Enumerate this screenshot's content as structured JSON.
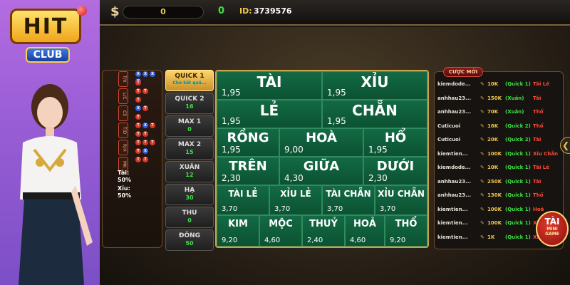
{
  "brand": {
    "logo_main": "HIT",
    "logo_sub": "CLUB"
  },
  "topbar": {
    "currency_symbol": "$",
    "balance": "0",
    "bonus": "0",
    "id_label": "ID:",
    "id_value": "3739576"
  },
  "stats": {
    "tags": [
      "T/X",
      "L/C",
      "CS",
      "T/D",
      "R/H",
      "MK"
    ],
    "rows": [
      [
        "X",
        "X",
        "X",
        "X"
      ],
      [
        "T"
      ],
      [
        "T",
        "T"
      ],
      [
        "T"
      ],
      [
        "X",
        "T"
      ],
      [
        "T"
      ],
      [
        "T",
        "X",
        "T"
      ],
      [
        "T",
        "T"
      ],
      [
        "T",
        "T",
        "T"
      ],
      [
        "T",
        "X"
      ],
      [
        "T",
        "T"
      ]
    ],
    "tai_label": "Tài:",
    "tai_pct": "50%",
    "xiu_label": "Xỉu:",
    "xiu_pct": "50%"
  },
  "tabs": [
    {
      "label": "QUICK 1",
      "count": "Chờ kết quả...",
      "active": true
    },
    {
      "label": "QUICK 2",
      "count": "16"
    },
    {
      "label": "MAX 1",
      "count": "0"
    },
    {
      "label": "MAX 2",
      "count": "15"
    },
    {
      "label": "XUÂN",
      "count": "12"
    },
    {
      "label": "HẠ",
      "count": "30"
    },
    {
      "label": "THU",
      "count": "0"
    },
    {
      "label": "ĐÔNG",
      "count": "50"
    }
  ],
  "board": {
    "row1": [
      {
        "name": "TÀI",
        "odd": "1,95"
      },
      {
        "name": "XỈU",
        "odd": "1,95"
      }
    ],
    "row2": [
      {
        "name": "LẺ",
        "odd": "1,95"
      },
      {
        "name": "CHẴN",
        "odd": "1,95"
      }
    ],
    "row3": [
      {
        "name": "RỒNG",
        "odd": "1,95"
      },
      {
        "name": "HOÀ",
        "odd": "9,00"
      },
      {
        "name": "HỔ",
        "odd": "1,95"
      }
    ],
    "row4": [
      {
        "name": "TRÊN",
        "odd": "2,30"
      },
      {
        "name": "GIỮA",
        "odd": "4,30"
      },
      {
        "name": "DƯỚI",
        "odd": "2,30"
      }
    ],
    "row5": [
      {
        "name": "TÀI LẺ",
        "odd": "3,70"
      },
      {
        "name": "XỈU LẺ",
        "odd": "3,70"
      },
      {
        "name": "TÀI CHẴN",
        "odd": "3,70"
      },
      {
        "name": "XỈU CHẴN",
        "odd": "3,70"
      }
    ],
    "row6": [
      {
        "name": "KIM",
        "odd": "9,20"
      },
      {
        "name": "MỘC",
        "odd": "4,60"
      },
      {
        "name": "THUỶ",
        "odd": "2,40"
      },
      {
        "name": "HOẢ",
        "odd": "4,60"
      },
      {
        "name": "THỔ",
        "odd": "9,20"
      }
    ]
  },
  "recent": {
    "title": "CƯỢC MỚI",
    "rows": [
      {
        "user": "kiemdode...",
        "amount": "10K",
        "mode": "(Quick 1)",
        "pick": "Tài Lẻ"
      },
      {
        "user": "anhhau23...",
        "amount": "150K",
        "mode": "(Xuân)",
        "pick": "Tài"
      },
      {
        "user": "anhhau23...",
        "amount": "70K",
        "mode": "(Xuân)",
        "pick": "Thổ"
      },
      {
        "user": "Cuticuoi",
        "amount": "16K",
        "mode": "(Quick 2)",
        "pick": "Thổ"
      },
      {
        "user": "Cuticuoi",
        "amount": "20K",
        "mode": "(Quick 2)",
        "pick": "Tài"
      },
      {
        "user": "kiemtien...",
        "amount": "100K",
        "mode": "(Quick 1)",
        "pick": "Xỉu Chẵn"
      },
      {
        "user": "kiemdode...",
        "amount": "10K",
        "mode": "(Quick 1)",
        "pick": "Tài Lẻ"
      },
      {
        "user": "anhhau23...",
        "amount": "250K",
        "mode": "(Quick 1)",
        "pick": "Tài"
      },
      {
        "user": "anhhau23...",
        "amount": "130K",
        "mode": "(Quick 1)",
        "pick": "Thổ"
      },
      {
        "user": "kiemtien...",
        "amount": "100K",
        "mode": "(Quick 1)",
        "pick": "Hoả"
      },
      {
        "user": "kiemtien...",
        "amount": "100K",
        "mode": "(Quick 1)",
        "pick": "Xỉu"
      },
      {
        "user": "kiemtien...",
        "amount": "1K",
        "mode": "(Quick 1)",
        "pick": "Xỉu"
      }
    ]
  },
  "mini_game": {
    "label": "TÀI",
    "text1": "MINI",
    "text2": "GAME"
  }
}
